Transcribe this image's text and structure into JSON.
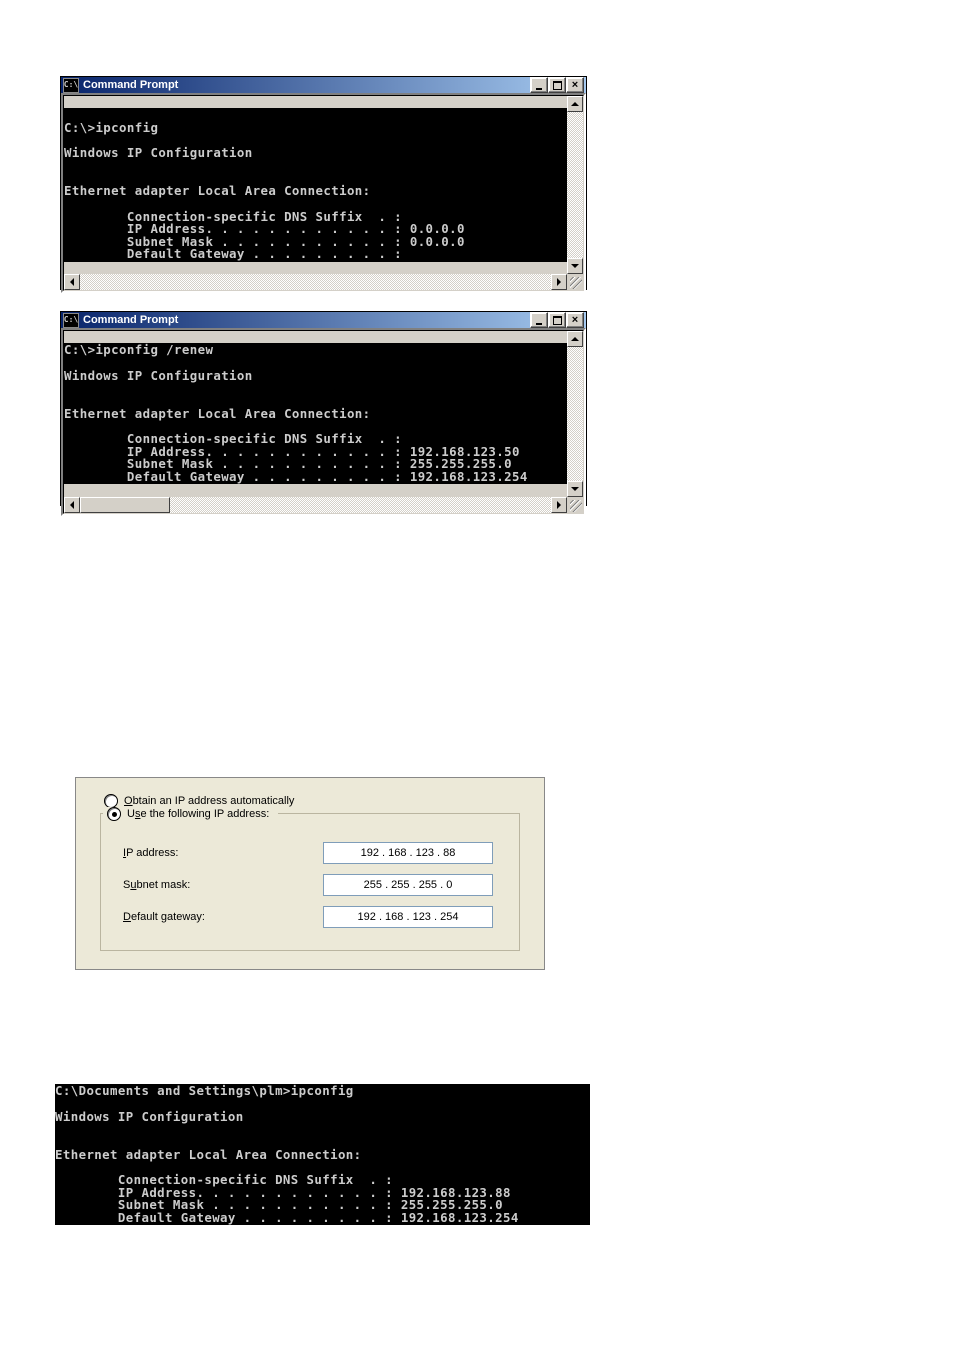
{
  "cmd1": {
    "title": "Command Prompt",
    "lines": [
      "",
      "C:\\>ipconfig",
      "",
      "Windows IP Configuration",
      "",
      "",
      "Ethernet adapter Local Area Connection:",
      "",
      "        Connection-specific DNS Suffix  . :",
      "        IP Address. . . . . . . . . . . . : 0.0.0.0",
      "        Subnet Mask . . . . . . . . . . . : 0.0.0.0",
      "        Default Gateway . . . . . . . . . :",
      ""
    ]
  },
  "cmd2": {
    "title": "Command Prompt",
    "lines": [
      "C:\\>ipconfig /renew",
      "",
      "Windows IP Configuration",
      "",
      "",
      "Ethernet adapter Local Area Connection:",
      "",
      "        Connection-specific DNS Suffix  . :",
      "        IP Address. . . . . . . . . . . . : 192.168.123.50",
      "        Subnet Mask . . . . . . . . . . . : 255.255.255.0",
      "        Default Gateway . . . . . . . . . : 192.168.123.254"
    ]
  },
  "ipdlg": {
    "obtain_pre": "O",
    "obtain_rest": "btain an IP address automatically",
    "use_pre": "U",
    "use_mid": "s",
    "use_rest": "e the following IP address:",
    "labels": {
      "ip_pre": "I",
      "ip_rest": "P address:",
      "mask_pre": "S",
      "mask_mid": "u",
      "mask_rest": "bnet mask:",
      "gw_pre": "D",
      "gw_rest": "efault gateway:"
    },
    "values": {
      "ip": "192 . 168 . 123 .  88",
      "mask": "255 . 255 . 255 .   0",
      "gw": "192 . 168 . 123 . 254"
    }
  },
  "cmd3": {
    "lines": [
      "C:\\Documents and Settings\\plm>ipconfig",
      "",
      "Windows IP Configuration",
      "",
      "",
      "Ethernet adapter Local Area Connection:",
      "",
      "        Connection-specific DNS Suffix  . :",
      "        IP Address. . . . . . . . . . . . : 192.168.123.88",
      "        Subnet Mask . . . . . . . . . . . : 255.255.255.0",
      "        Default Gateway . . . . . . . . . : 192.168.123.254"
    ]
  },
  "icon_text": "C:\\"
}
